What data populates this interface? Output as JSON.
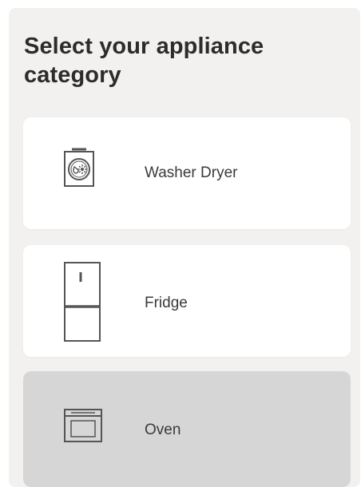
{
  "header": {
    "title_line1": "Select your appliance",
    "title_line2": "category"
  },
  "categories": [
    {
      "label": "Washer Dryer",
      "icon": "washer-dryer-icon",
      "selected": false
    },
    {
      "label": "Fridge",
      "icon": "fridge-icon",
      "selected": false
    },
    {
      "label": "Oven",
      "icon": "oven-icon",
      "selected": true
    }
  ],
  "colors": {
    "panel_background": "#f2f1ef",
    "card_background": "#ffffff",
    "selected_card_background": "#d6d6d6",
    "text": "#2c2c2c"
  }
}
